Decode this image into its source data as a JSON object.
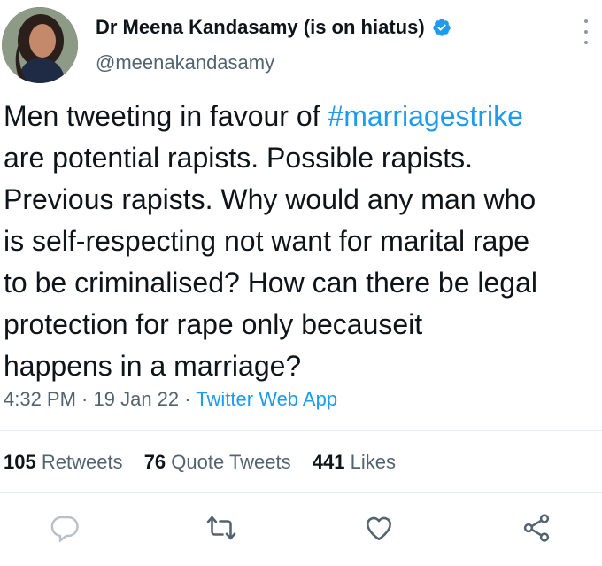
{
  "author": {
    "display_name": "Dr Meena Kandasamy (is on hiatus)",
    "handle": "@meenakandasamy",
    "verified": true
  },
  "tweet": {
    "lines": [
      {
        "before": "Men tweeting in favour of ",
        "hashtag": "#marriagestrike"
      },
      {
        "text": "are potential rapists. Possible rapists."
      },
      {
        "text": "Previous rapists. Why would any man who"
      },
      {
        "text": "is self-respecting not want for marital rape"
      },
      {
        "text": "to be criminalised? How can there be legal"
      },
      {
        "text": "protection for rape only becauseit"
      },
      {
        "text": "happens in a marriage?"
      }
    ]
  },
  "meta": {
    "time": "4:32 PM",
    "separator": " · ",
    "date": "19 Jan 22",
    "app": "Twitter Web App"
  },
  "stats": {
    "retweets": {
      "count": "105",
      "label": "Retweets"
    },
    "quotes": {
      "count": "76",
      "label": "Quote Tweets"
    },
    "likes": {
      "count": "441",
      "label": "Likes"
    }
  },
  "colors": {
    "link": "#1d9bf0",
    "secondary_text": "#536471",
    "icon": "#536471"
  },
  "icons": [
    "verified-badge-icon",
    "more-options-icon",
    "reply-icon",
    "retweet-icon",
    "like-icon",
    "share-icon"
  ]
}
